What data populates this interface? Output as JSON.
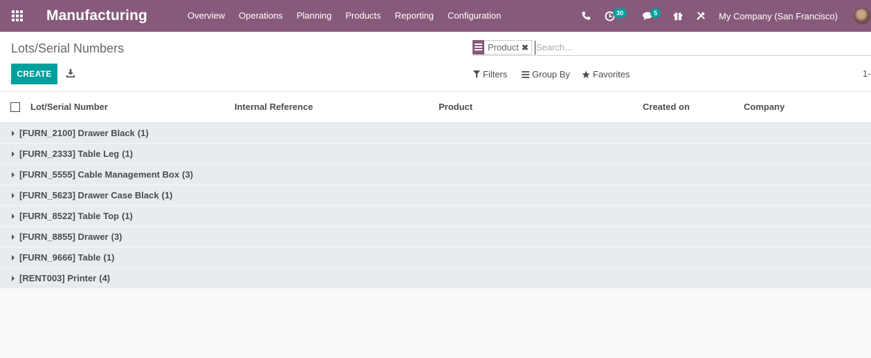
{
  "navbar": {
    "app_title": "Manufacturing",
    "menu": [
      "Overview",
      "Operations",
      "Planning",
      "Products",
      "Reporting",
      "Configuration"
    ],
    "activity_badge": "30",
    "messages_badge": "5",
    "company": "My Company (San Francisco)",
    "icons": [
      "apps-icon",
      "phone-icon",
      "clock-icon",
      "chat-icon",
      "gift-icon",
      "tools-icon"
    ]
  },
  "control_panel": {
    "breadcrumb": "Lots/Serial Numbers",
    "create_label": "CREATE",
    "search": {
      "facet_label": "Product",
      "placeholder": "Search..."
    },
    "filters_label": "Filters",
    "group_by_label": "Group By",
    "favorites_label": "Favorites",
    "pager": "1-"
  },
  "list": {
    "columns": [
      "Lot/Serial Number",
      "Internal Reference",
      "Product",
      "Created on",
      "Company"
    ],
    "groups": [
      {
        "label": "[FURN_2100] Drawer Black",
        "count": "(1)"
      },
      {
        "label": "[FURN_2333] Table Leg",
        "count": "(1)"
      },
      {
        "label": "[FURN_5555] Cable Management Box",
        "count": "(3)"
      },
      {
        "label": "[FURN_5623] Drawer Case Black",
        "count": "(1)"
      },
      {
        "label": "[FURN_8522] Table Top",
        "count": "(1)"
      },
      {
        "label": "[FURN_8855] Drawer",
        "count": "(3)"
      },
      {
        "label": "[FURN_9666] Table",
        "count": "(1)"
      },
      {
        "label": "[RENT003] Printer",
        "count": "(4)"
      }
    ]
  },
  "colors": {
    "brand": "#875a7b",
    "primary_button": "#00a09d",
    "badge": "#00a09d",
    "group_row": "#e9ecef"
  }
}
